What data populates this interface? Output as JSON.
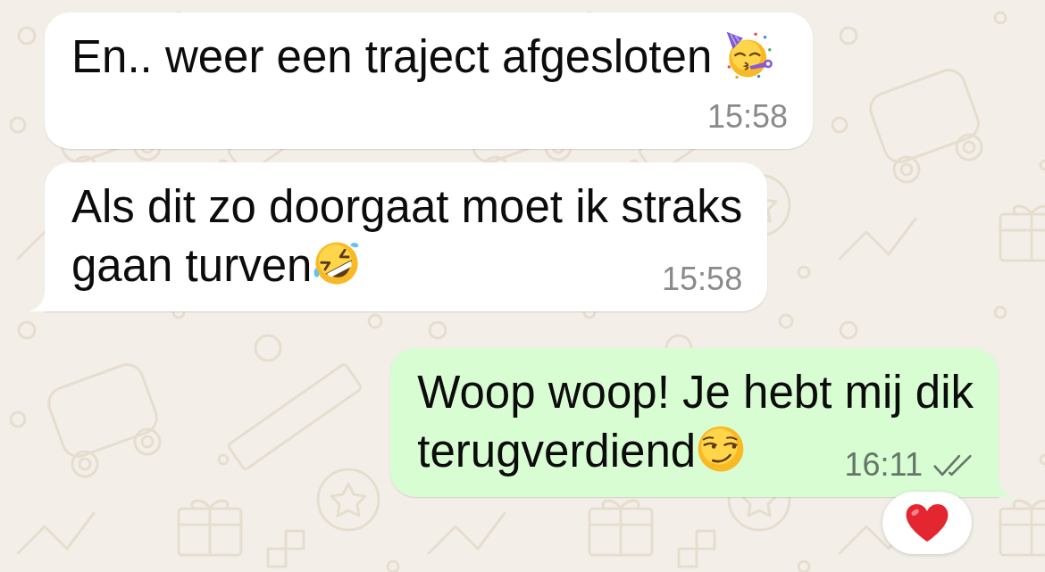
{
  "chat": {
    "messages": [
      {
        "outgoing": false,
        "lines": [
          "En.. weer een traject afgesloten "
        ],
        "emoji": {
          "kind": "partying-face"
        },
        "time": "15:58"
      },
      {
        "outgoing": false,
        "lines": [
          "Als dit zo doorgaat moet ik straks",
          "gaan turven"
        ],
        "emoji": {
          "kind": "rolling-laughing-face"
        },
        "time": "15:58"
      },
      {
        "outgoing": true,
        "lines": [
          "Woop woop! Je hebt mij dik",
          "terugverdiend"
        ],
        "emoji": {
          "kind": "smirking-face"
        },
        "time": "16:11",
        "delivered": true,
        "read": false,
        "reaction": {
          "kind": "red-heart"
        }
      }
    ]
  }
}
